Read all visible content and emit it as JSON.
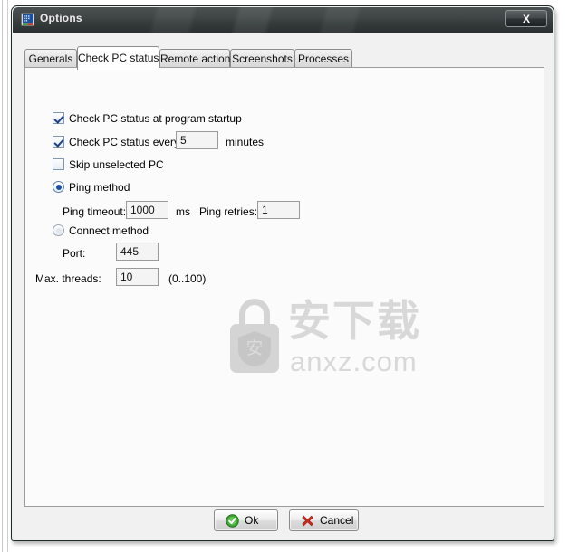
{
  "window": {
    "title": "Options",
    "icon": "app-icon",
    "close_label": "X"
  },
  "tabs": [
    {
      "label": "Generals",
      "active": false
    },
    {
      "label": "Check PC status",
      "active": true
    },
    {
      "label": "Remote action",
      "active": false
    },
    {
      "label": "Screenshots",
      "active": false
    },
    {
      "label": "Processes",
      "active": false
    }
  ],
  "form": {
    "check_at_startup": {
      "label": "Check PC status at program startup",
      "checked": true
    },
    "check_every": {
      "label": "Check PC status every",
      "checked": true,
      "value": "5",
      "unit": "minutes"
    },
    "skip_unselected": {
      "label": "Skip unselected PC",
      "checked": false
    },
    "ping_method": {
      "label": "Ping method",
      "selected": true
    },
    "ping_timeout": {
      "label": "Ping timeout:",
      "value": "1000",
      "unit": "ms"
    },
    "ping_retries": {
      "label": "Ping retries:",
      "value": "1"
    },
    "connect_method": {
      "label": "Connect method",
      "selected": false
    },
    "port": {
      "label": "Port:",
      "value": "445"
    },
    "max_threads": {
      "label": "Max. threads:",
      "value": "10",
      "range": "(0..100)"
    }
  },
  "footer": {
    "ok_label": "Ok",
    "cancel_label": "Cancel"
  },
  "watermark": {
    "chinese": "安下载",
    "url": "anxz.com",
    "badge": "安"
  },
  "colors": {
    "titlebar_dark": "#2b3030",
    "panel_bg": "#fbfbfb",
    "client_bg": "#f1f1f1",
    "accent_blue": "#1b4fa8",
    "ok_green": "#3fa832",
    "cancel_red": "#cc2b1d",
    "watermark_gray": "#d8d8d8"
  }
}
